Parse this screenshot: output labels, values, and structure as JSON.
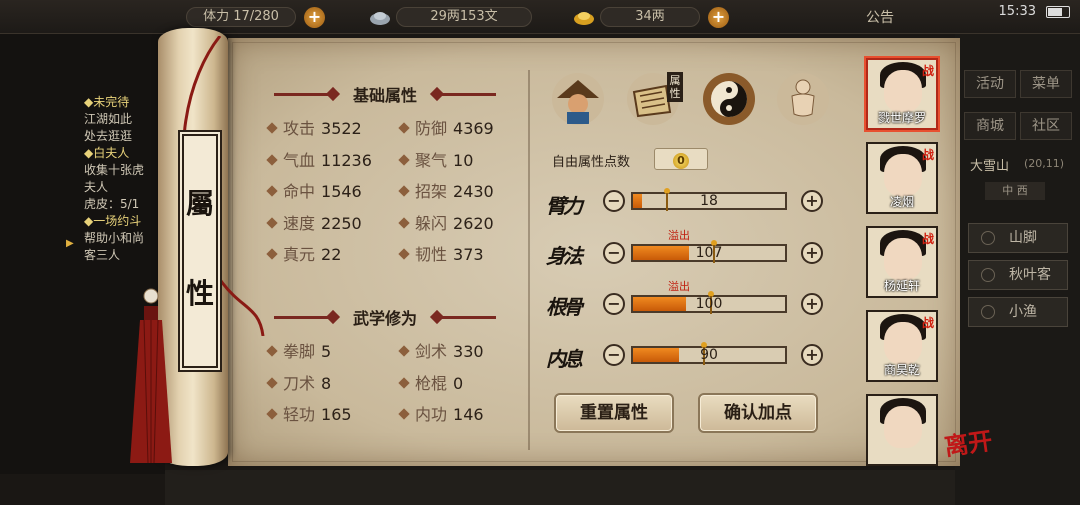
{
  "hud": {
    "res1_text": "体力 17/280",
    "res2_text": "29两153文",
    "res3_text": "34两",
    "notice": "公告",
    "clock": "15:33"
  },
  "quests": {
    "q1_title": "◆未完待",
    "q1_lines": [
      "江湖如此",
      "处去逛逛"
    ],
    "q2_title": "◆白夫人",
    "q2_lines": [
      "收集十张虎",
      "夫人",
      "虎皮：5/1"
    ],
    "q3_title": "◆一场约斗",
    "q3_lines": [
      "帮助小和尚",
      "客三人"
    ]
  },
  "right_menu": {
    "activity": "活动",
    "menu": "菜单",
    "mall": "商城",
    "community": "社区",
    "map_name": "大雪山",
    "map_coord": "(20,11)",
    "map_bar": "中 西",
    "locations": [
      "山脚",
      "秋叶客",
      "小渔"
    ]
  },
  "scroll": {
    "plaque_top": "屬",
    "plaque_bottom": "性"
  },
  "basic": {
    "title": "基础属性",
    "stats": [
      {
        "name": "攻击",
        "value": "3522"
      },
      {
        "name": "防御",
        "value": "4369"
      },
      {
        "name": "气血",
        "value": "11236"
      },
      {
        "name": "聚气",
        "value": "10"
      },
      {
        "name": "命中",
        "value": "1546"
      },
      {
        "name": "招架",
        "value": "2430"
      },
      {
        "name": "速度",
        "value": "2250"
      },
      {
        "name": "躲闪",
        "value": "2620"
      },
      {
        "name": "真元",
        "value": "22"
      },
      {
        "name": "韧性",
        "value": "373"
      }
    ]
  },
  "martial": {
    "title": "武学修为",
    "stats": [
      {
        "name": "拳脚",
        "value": "5"
      },
      {
        "name": "剑术",
        "value": "330"
      },
      {
        "name": "刀术",
        "value": "8"
      },
      {
        "name": "枪棍",
        "value": "0"
      },
      {
        "name": "轻功",
        "value": "165"
      },
      {
        "name": "内功",
        "value": "146"
      }
    ]
  },
  "tabs": {
    "attr_tab_label": "属性"
  },
  "points": {
    "free_label": "自由属性点数",
    "free_value": "0",
    "attrs": [
      {
        "name": "臂力",
        "value": "18",
        "fill": 0.06,
        "overflow": ""
      },
      {
        "name": "身法",
        "value": "107",
        "fill": 0.37,
        "overflow": "溢出"
      },
      {
        "name": "根骨",
        "value": "100",
        "fill": 0.35,
        "overflow": "溢出"
      },
      {
        "name": "内息",
        "value": "90",
        "fill": 0.3,
        "overflow": ""
      }
    ],
    "minus_symbol": "−",
    "plus_symbol": "+"
  },
  "actions": {
    "reset": "重置属性",
    "confirm": "确认加点"
  },
  "party": {
    "members": [
      {
        "name": "戮世摩罗",
        "tag": "战"
      },
      {
        "name": "凌烟",
        "tag": "战"
      },
      {
        "name": "杨延轩",
        "tag": "战"
      },
      {
        "name": "商昊乾",
        "tag": "战"
      },
      {
        "name": "",
        "tag": ""
      }
    ],
    "leave": "离开"
  },
  "colors": {
    "accent_red": "#7a2820",
    "bar_fill": "#f08a20",
    "overflow_red": "#c02010"
  }
}
